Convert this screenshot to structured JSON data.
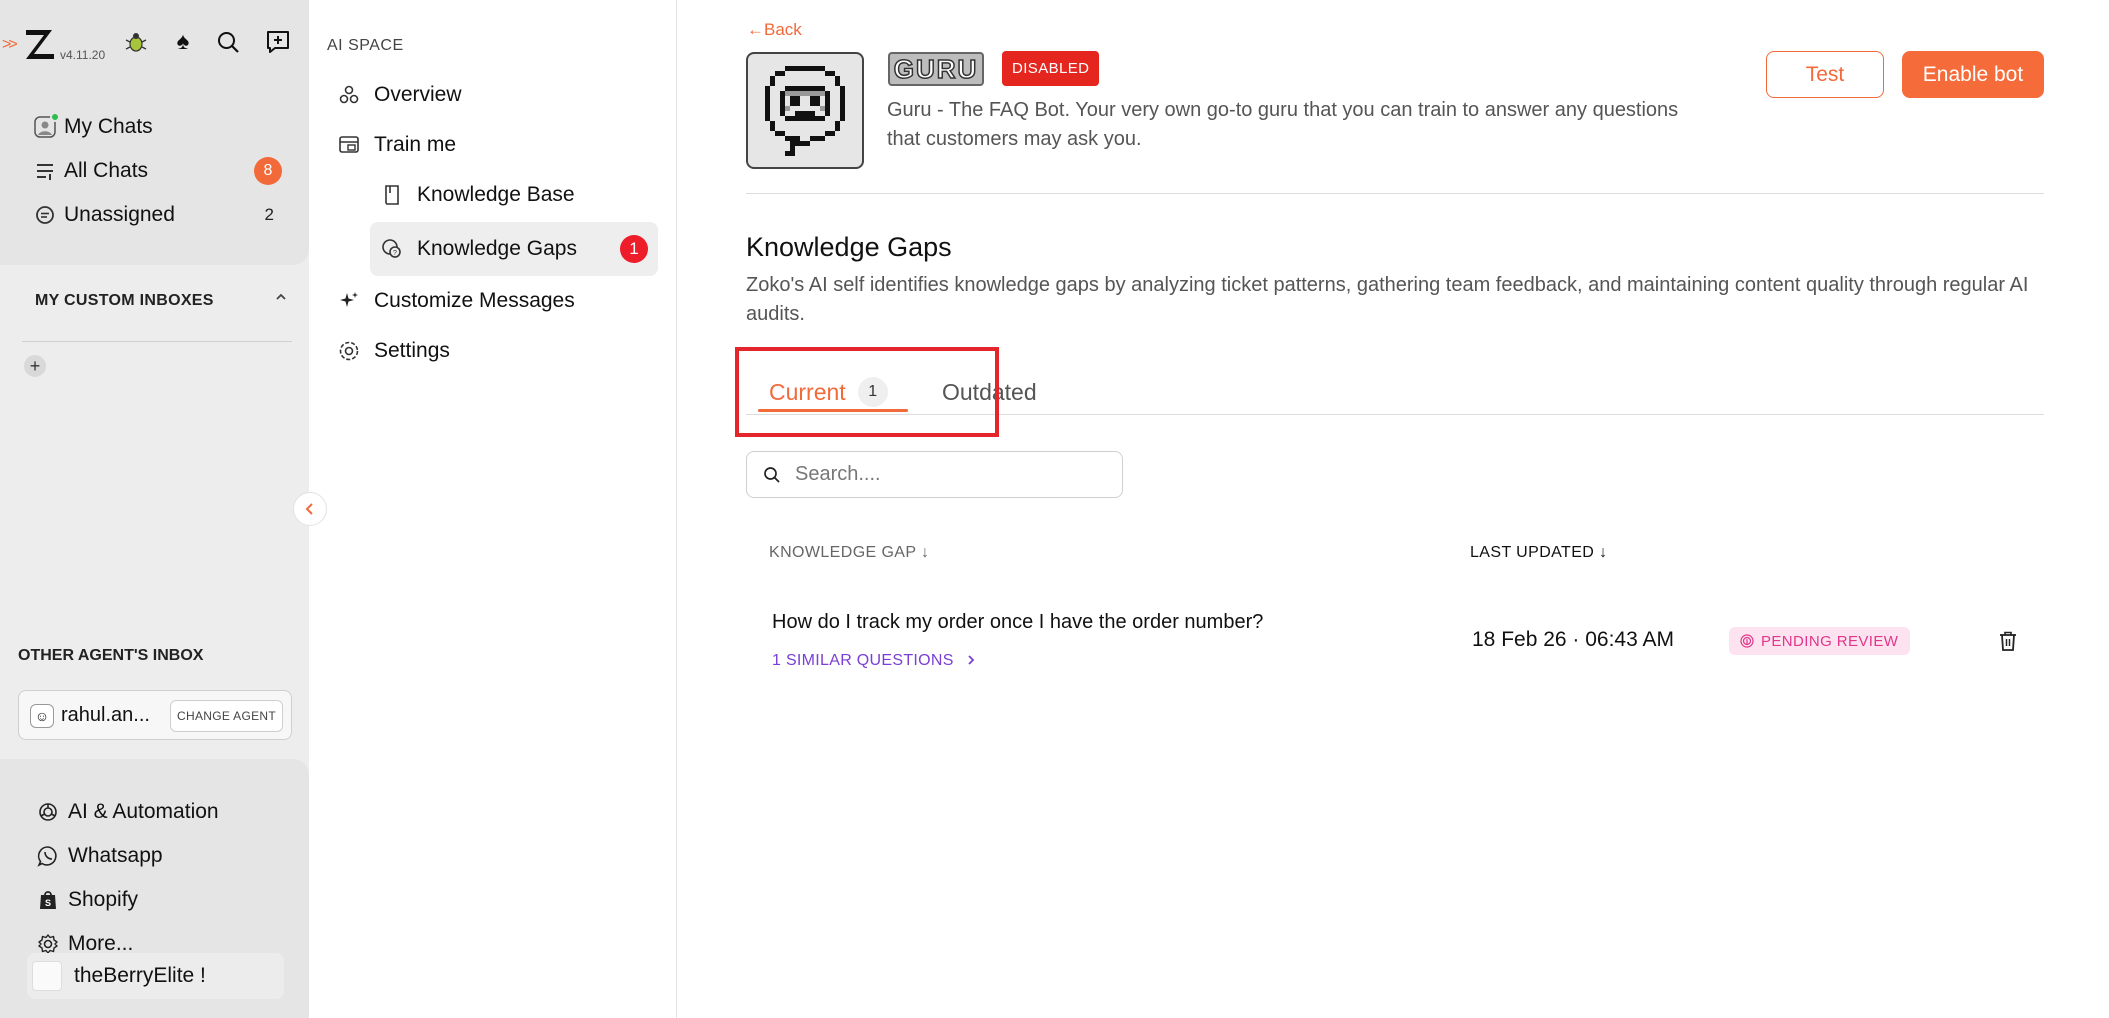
{
  "app": {
    "version": "v4.11.20"
  },
  "rail": {
    "inbox_items": [
      {
        "label": "My Chats",
        "icon": "avatar-icon"
      },
      {
        "label": "All Chats",
        "count": "8",
        "icon": "list-icon"
      },
      {
        "label": "Unassigned",
        "count": "2",
        "icon": "chat-bubble-icon"
      }
    ],
    "custom_inboxes_heading": "MY CUSTOM INBOXES",
    "other_inbox_heading": "OTHER AGENT'S INBOX",
    "agent_name": "rahul.an...",
    "change_agent_label": "CHANGE AGENT",
    "apps": [
      {
        "label": "AI & Automation",
        "icon": "openai-icon"
      },
      {
        "label": "Whatsapp",
        "icon": "whatsapp-icon"
      },
      {
        "label": "Shopify",
        "icon": "shopify-icon"
      },
      {
        "label": "More...",
        "icon": "gear-icon"
      }
    ],
    "store_name": "theBerryElite !"
  },
  "subnav": {
    "heading": "AI SPACE",
    "items": [
      {
        "label": "Overview"
      },
      {
        "label": "Train me"
      },
      {
        "label": "Knowledge Base"
      },
      {
        "label": "Knowledge Gaps",
        "badge": "1"
      },
      {
        "label": "Customize Messages"
      },
      {
        "label": "Settings"
      }
    ]
  },
  "header": {
    "back_label": "Back",
    "bot_logo_text": "GURU",
    "status_badge": "DISABLED",
    "description": "Guru - The FAQ Bot. Your very own go-to guru that you can train to answer any questions that customers may ask you.",
    "test_label": "Test",
    "enable_label": "Enable bot"
  },
  "knowledge_gaps": {
    "title": "Knowledge Gaps",
    "description": "Zoko's AI self identifies knowledge gaps by analyzing ticket patterns, gathering team feedback, and maintaining content quality through regular AI audits.",
    "tabs": [
      {
        "label": "Current",
        "count": "1",
        "active": true
      },
      {
        "label": "Outdated",
        "active": false
      }
    ],
    "search_placeholder": "Search....",
    "columns": {
      "gap": "KNOWLEDGE GAP ↓",
      "updated": "LAST UPDATED ↓"
    },
    "rows": [
      {
        "question": "How do I track my order once I have the order number?",
        "similar": "1 SIMILAR QUESTIONS",
        "updated": "18 Feb 26 · 06:43 AM",
        "status": "PENDING REVIEW"
      }
    ]
  },
  "colors": {
    "accent": "#f26a3a",
    "danger": "#e4261e",
    "pending_bg": "#fde3f0",
    "pending_text": "#e0368c",
    "link_purple": "#7a3fd6"
  }
}
